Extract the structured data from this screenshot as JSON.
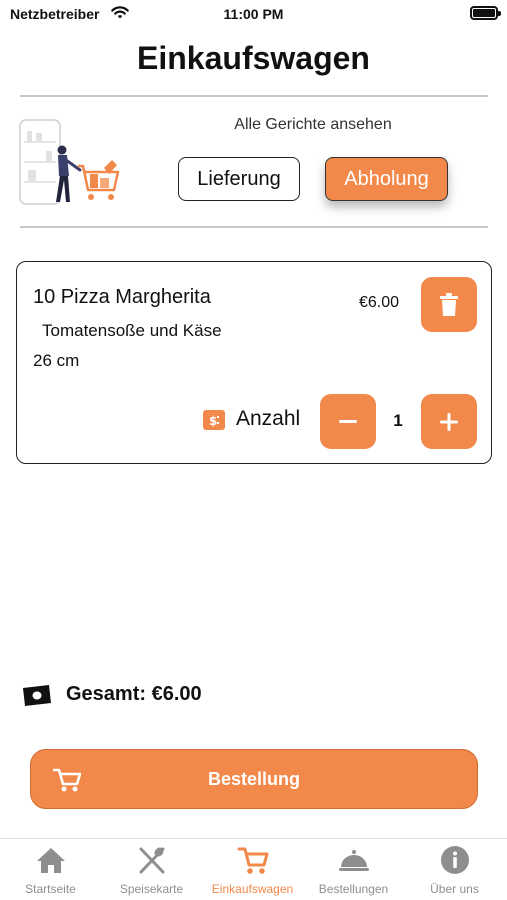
{
  "status_bar": {
    "carrier": "Netzbetreiber",
    "time": "11:00 PM"
  },
  "title": "Einkaufswagen",
  "view_all_link": "Alle Gerichte ansehen",
  "fulfillment": {
    "options": [
      "Lieferung",
      "Abholung"
    ],
    "selected": "Abholung"
  },
  "cart": {
    "items": [
      {
        "name": "10 Pizza Margherita",
        "description": "Tomatensoße und Käse",
        "size": "26 cm",
        "price": "€6.00",
        "quantity_label": "Anzahl",
        "quantity": "1"
      }
    ]
  },
  "total": "Gesamt: €6.00",
  "order_button": "Bestellung",
  "tabs": [
    {
      "label": "Startseite",
      "icon": "home-icon",
      "active": false
    },
    {
      "label": "Speisekarte",
      "icon": "utensils-icon",
      "active": false
    },
    {
      "label": "Einkaufswagen",
      "icon": "cart-icon",
      "active": true
    },
    {
      "label": "Bestellungen",
      "icon": "cloche-icon",
      "active": false
    },
    {
      "label": "Über uns",
      "icon": "info-icon",
      "active": false
    }
  ],
  "colors": {
    "accent": "#f2894a",
    "inactive_tab": "#8e8e8e",
    "text": "#111111"
  }
}
